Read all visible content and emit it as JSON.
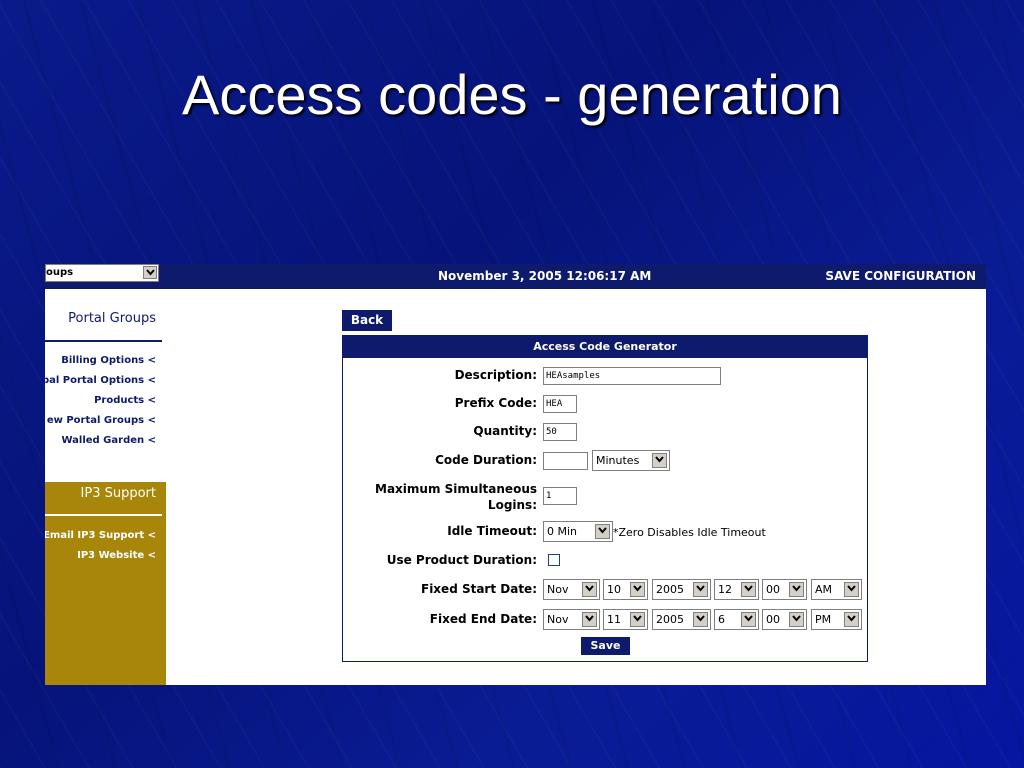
{
  "slide_title": "Access codes - generation",
  "topbar": {
    "groups_select_value": "oups",
    "datetime": "November 3, 2005 12:06:17 AM",
    "save_configuration": "SAVE CONFIGURATION"
  },
  "sidebar": {
    "portal_groups_heading": "Portal Groups",
    "items": [
      {
        "label": "Billing Options <"
      },
      {
        "label": "bal Portal Options <"
      },
      {
        "label": "Products <"
      },
      {
        "label": "ew Portal Groups <"
      },
      {
        "label": "Walled Garden <"
      }
    ],
    "support_heading": "IP3 Support",
    "support_items": [
      {
        "label": "Email IP3 Support <"
      },
      {
        "label": "IP3 Website <"
      }
    ]
  },
  "back_label": "Back",
  "form": {
    "title": "Access Code Generator",
    "description": {
      "label": "Description:",
      "value": "HEAsamples"
    },
    "prefix": {
      "label": "Prefix Code:",
      "value": "HEA"
    },
    "quantity": {
      "label": "Quantity:",
      "value": "50"
    },
    "duration": {
      "label": "Code Duration:",
      "value": "",
      "unit": "Minutes"
    },
    "max_logins": {
      "label_line1": "Maximum Simultaneous",
      "label_line2": "Logins:",
      "value": "1"
    },
    "idle_timeout": {
      "label": "Idle Timeout:",
      "value": "0 Min",
      "note": "*Zero Disables Idle Timeout"
    },
    "use_product_duration": {
      "label": "Use Product Duration:",
      "checked": false
    },
    "fixed_start": {
      "label": "Fixed Start Date:",
      "month": "Nov",
      "day": "10",
      "year": "2005",
      "hour": "12",
      "minute": "00",
      "ampm": "AM"
    },
    "fixed_end": {
      "label": "Fixed End Date:",
      "month": "Nov",
      "day": "11",
      "year": "2005",
      "hour": "6",
      "minute": "00",
      "ampm": "PM"
    },
    "save_label": "Save"
  },
  "colors": {
    "navy": "#0e1a6b",
    "gold": "#a8860a",
    "slide_bg": "#0a1a8a"
  }
}
